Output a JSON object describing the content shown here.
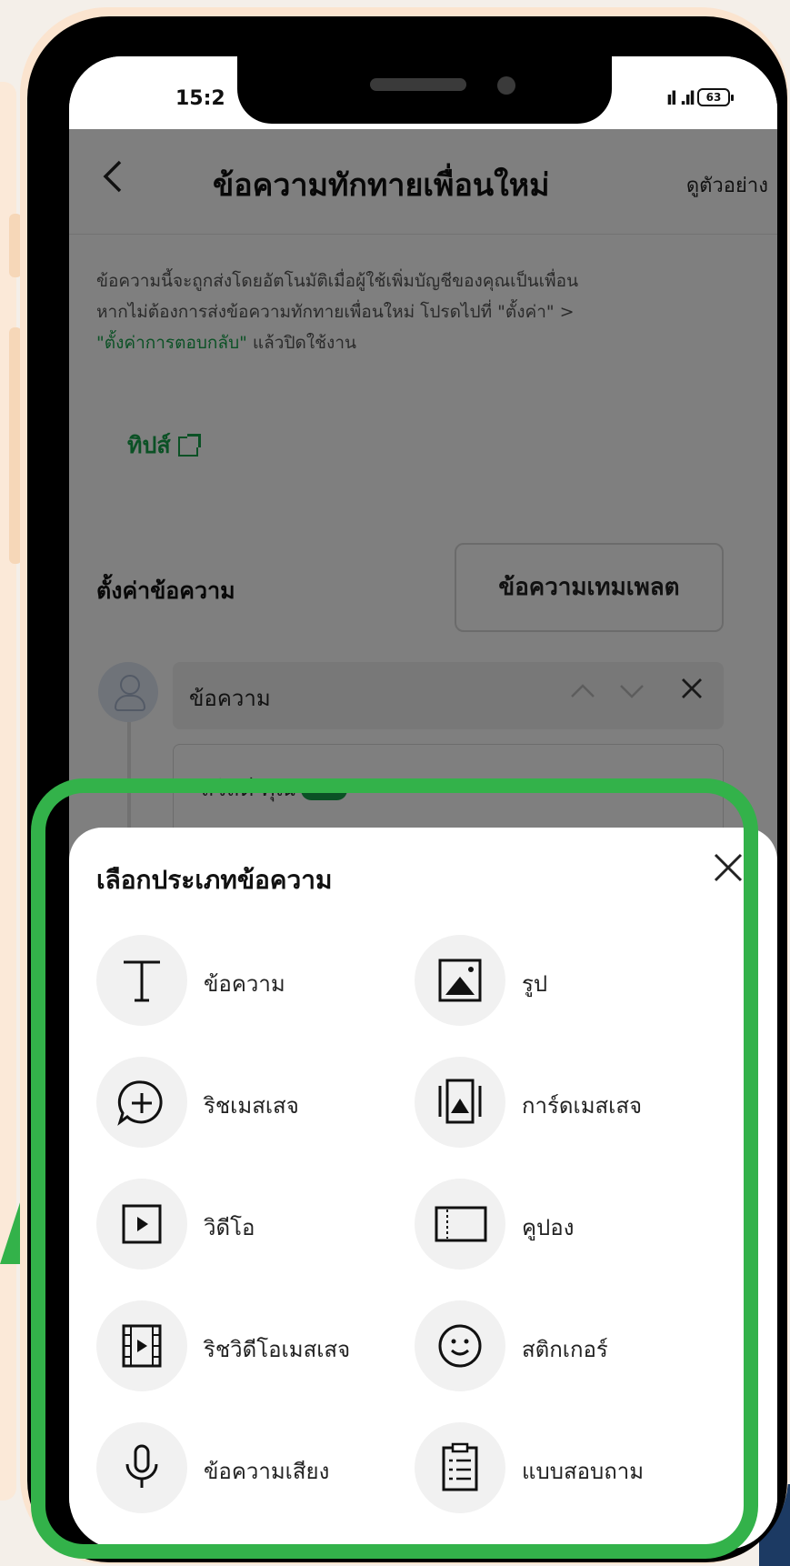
{
  "status_bar": {
    "time": "15:2",
    "signal": "ıl .ıl",
    "battery": "63"
  },
  "header": {
    "back_icon": "chevron-left-icon",
    "title": "ข้อความทักทายเพื่อนใหม่",
    "preview_link": "ดูตัวอย่าง"
  },
  "description": {
    "line1": "ข้อความนี้จะถูกส่งโดยอัตโนมัติเมื่อผู้ใช้เพิ่มบัญชีของคุณเป็นเพื่อน",
    "line2": "หากไม่ต้องการส่งข้อความทักทายเพื่อนใหม่ โปรดไปที่ \"ตั้งค่า\" >",
    "line3_link": "\"ตั้งค่าการตอบกลับ\"",
    "line3_rest": " แล้วปิดใช้งาน"
  },
  "tips": {
    "label": "ทิปส์",
    "icon": "external-link-icon"
  },
  "message_settings": {
    "label": "ตั้งค่าข้อความ",
    "template_button": "ข้อความเทมเพลต"
  },
  "message_block": {
    "label": "ข้อความ",
    "controls": [
      "chevron-up-icon",
      "chevron-down-icon",
      "close-icon"
    ],
    "preview_text": "สวัสดี คุณ"
  },
  "sheet": {
    "title": "เลือกประเภทข้อความ",
    "close_icon": "close-icon",
    "options": [
      {
        "label": "ข้อความ",
        "icon": "text-icon",
        "glyph": "T"
      },
      {
        "label": "รูป",
        "icon": "image-icon",
        "glyph": "▲"
      },
      {
        "label": "ริชเมสเสจ",
        "icon": "rich-message-icon",
        "glyph": "+"
      },
      {
        "label": "การ์ดเมสเสจ",
        "icon": "card-message-icon",
        "glyph": "▲"
      },
      {
        "label": "วิดีโอ",
        "icon": "video-icon",
        "glyph": "▶"
      },
      {
        "label": "คูปอง",
        "icon": "coupon-icon",
        "glyph": ""
      },
      {
        "label": "ริชวิดีโอเมสเสจ",
        "icon": "rich-video-icon",
        "glyph": "▶"
      },
      {
        "label": "สติกเกอร์",
        "icon": "sticker-icon",
        "glyph": "☺"
      },
      {
        "label": "ข้อความเสียง",
        "icon": "microphone-icon",
        "glyph": "🎤"
      },
      {
        "label": "แบบสอบถาม",
        "icon": "survey-icon",
        "glyph": "☰"
      }
    ]
  },
  "colors": {
    "accent_green": "#16a34a",
    "highlight_green": "#33b24a",
    "dim_overlay": "rgba(0,0,0,0.5)"
  }
}
